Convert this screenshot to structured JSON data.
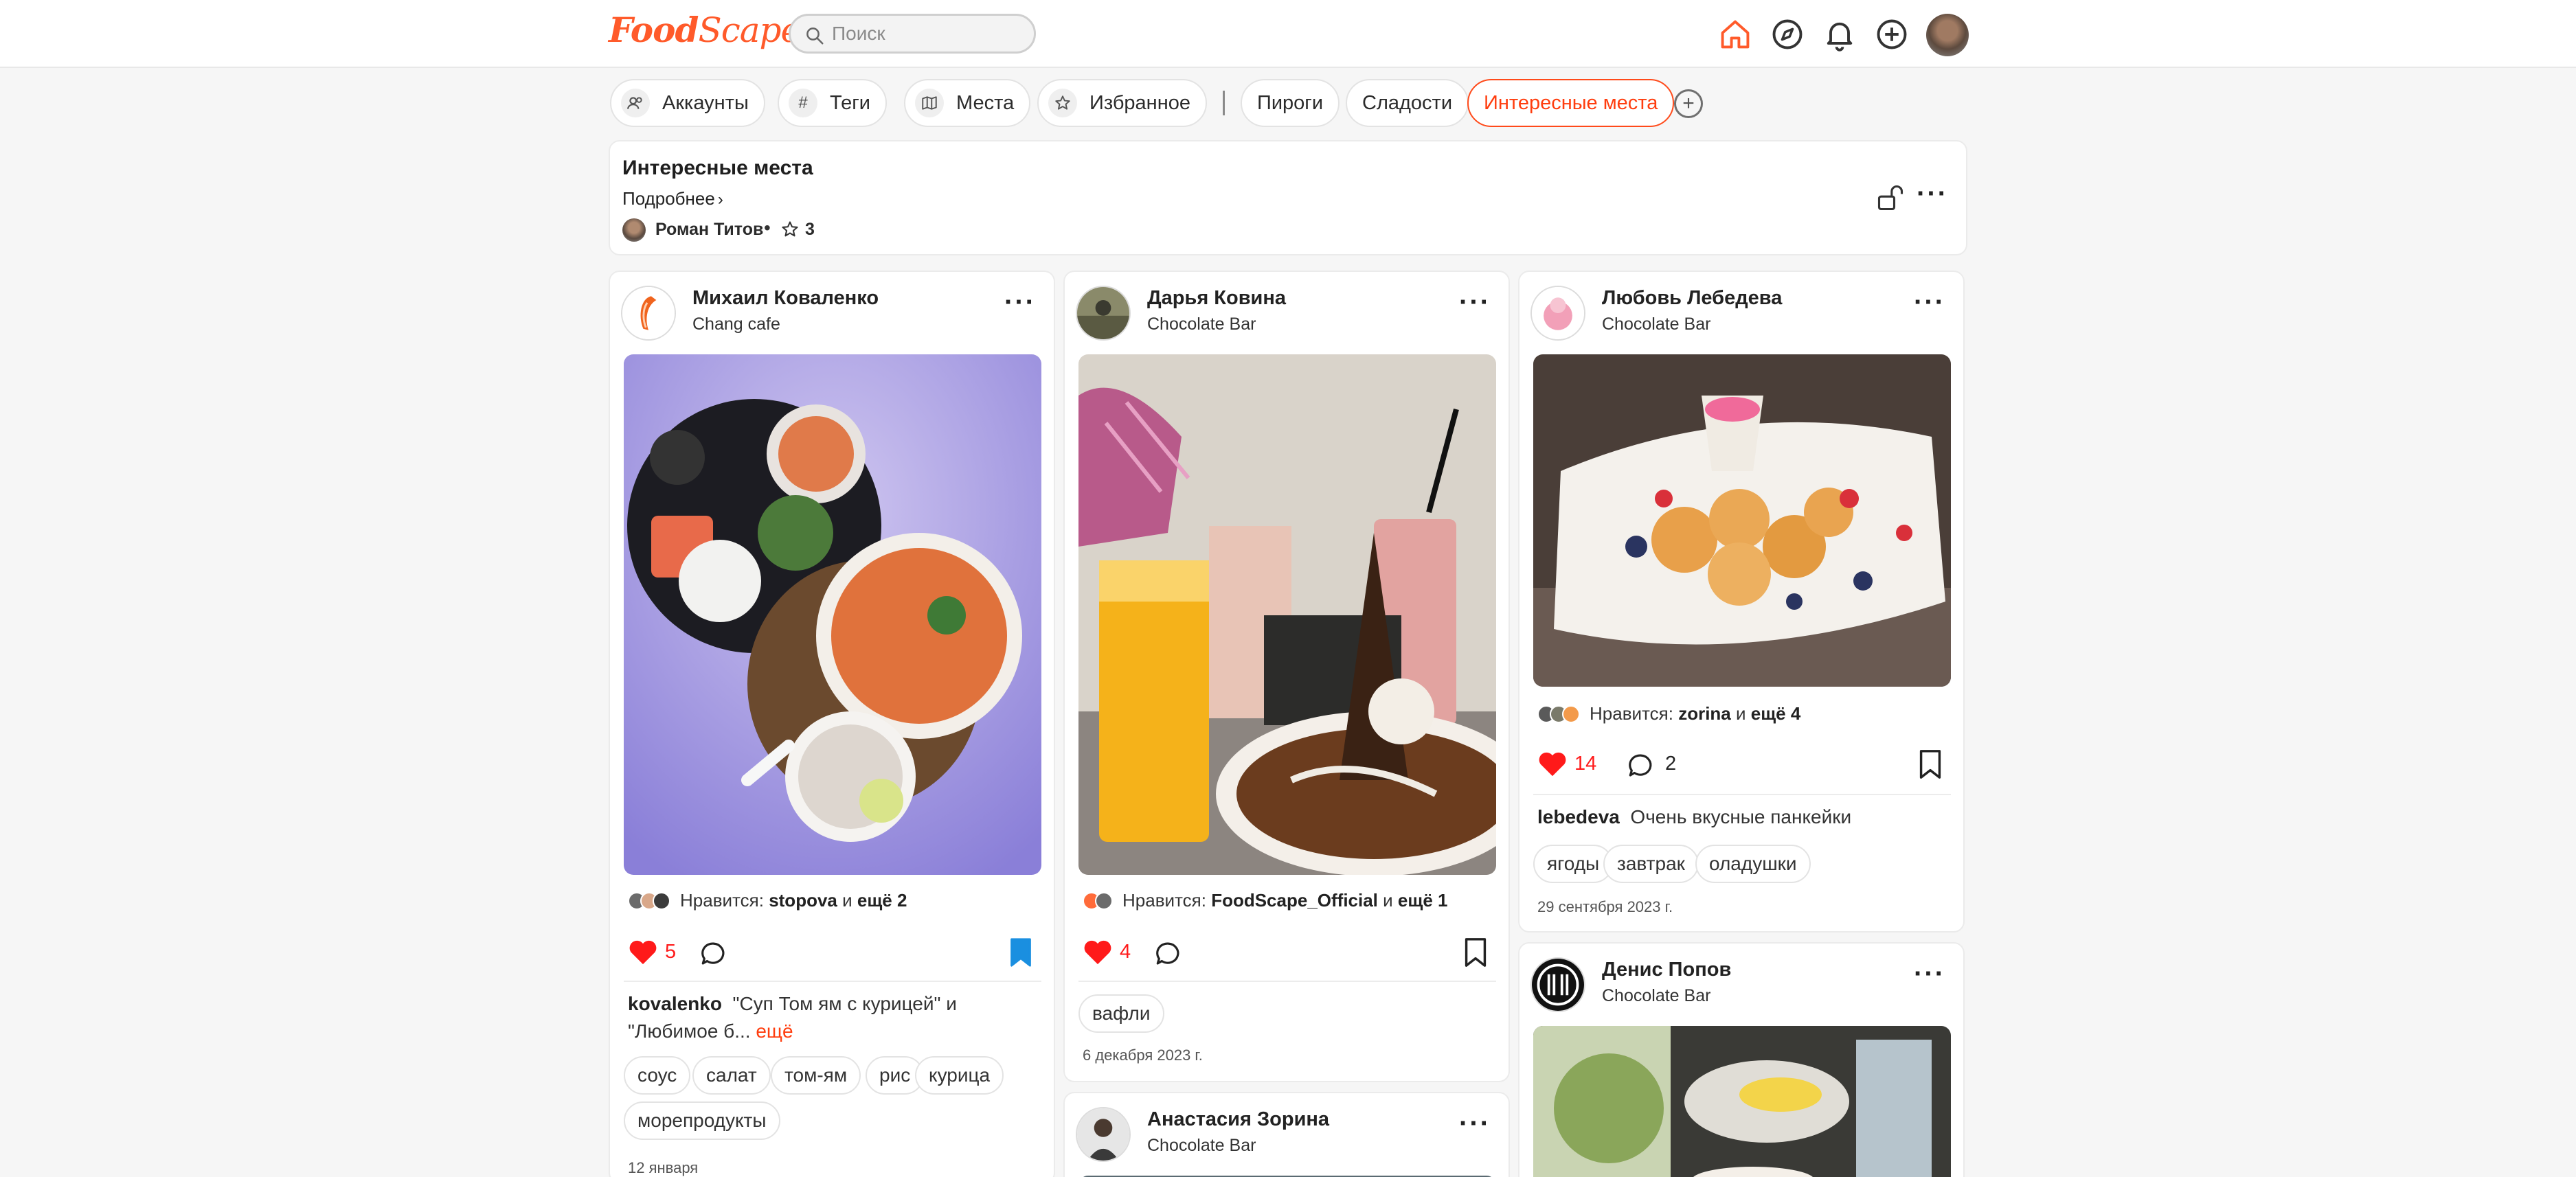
{
  "header": {
    "logo_food": "Food",
    "logo_scape": "Scape",
    "search_placeholder": "Поиск",
    "icons": [
      "home-icon",
      "compass-icon",
      "bell-icon",
      "plus-circle-icon",
      "avatar"
    ],
    "accent": "#ff5a2a"
  },
  "tabs": {
    "items": [
      {
        "label": "Аккаунты",
        "icon": "accounts-icon"
      },
      {
        "label": "Теги",
        "icon": "hash-icon"
      },
      {
        "label": "Места",
        "icon": "map-icon"
      },
      {
        "label": "Избранное",
        "icon": "star-icon"
      },
      {
        "label": "Пироги"
      },
      {
        "label": "Сладости"
      },
      {
        "label": "Интересные места",
        "active": true
      }
    ],
    "add_icon": "plus-circle-icon"
  },
  "collection": {
    "title": "Интересные места",
    "more": "Подробнее",
    "author": "Роман Титов",
    "dot": "•",
    "stars": "3"
  },
  "posts": [
    {
      "author": "Михаил Коваленко",
      "place": "Chang cafe",
      "likes_prefix": "Нравится:",
      "likes_user": "stopova",
      "likes_and": "и",
      "likes_more": "ещё 2",
      "like_count": "5",
      "comment_count": "",
      "bookmarked": true,
      "caption_user": "kovalenko",
      "caption": "\"Суп Том ям с курицей\" и \"Любимое б...",
      "caption_more": "ещё",
      "tags": [
        "соус",
        "салат",
        "том-ям",
        "рис",
        "курица",
        "морепродукты"
      ],
      "date": "12 января"
    },
    {
      "author": "Дарья Ковина",
      "place": "Chocolate Bar",
      "likes_prefix": "Нравится:",
      "likes_user": "FoodScape_Official",
      "likes_and": "и",
      "likes_more": "ещё 1",
      "like_count": "4",
      "comment_count": "",
      "bookmarked": false,
      "tags": [
        "вафли"
      ],
      "date": "6 декабря 2023 г."
    },
    {
      "author": "Любовь Лебедева",
      "place": "Chocolate Bar",
      "likes_prefix": "Нравится:",
      "likes_user": "zorina",
      "likes_and": "и",
      "likes_more": "ещё 4",
      "like_count": "14",
      "comment_count": "2",
      "bookmarked": false,
      "caption_user": "lebedeva",
      "caption": "Очень вкусные панкейки",
      "tags": [
        "ягоды",
        "завтрак",
        "оладушки"
      ],
      "date": "29 сентября 2023 г."
    },
    {
      "author": "Анастасия Зорина",
      "place": "Chocolate Bar"
    },
    {
      "author": "Денис Попов",
      "place": "Chocolate Bar"
    }
  ],
  "colors": {
    "like_red": "#ff1a1a",
    "bookmark_blue": "#1a8fe0",
    "active_tab": "#ff3d0e"
  }
}
